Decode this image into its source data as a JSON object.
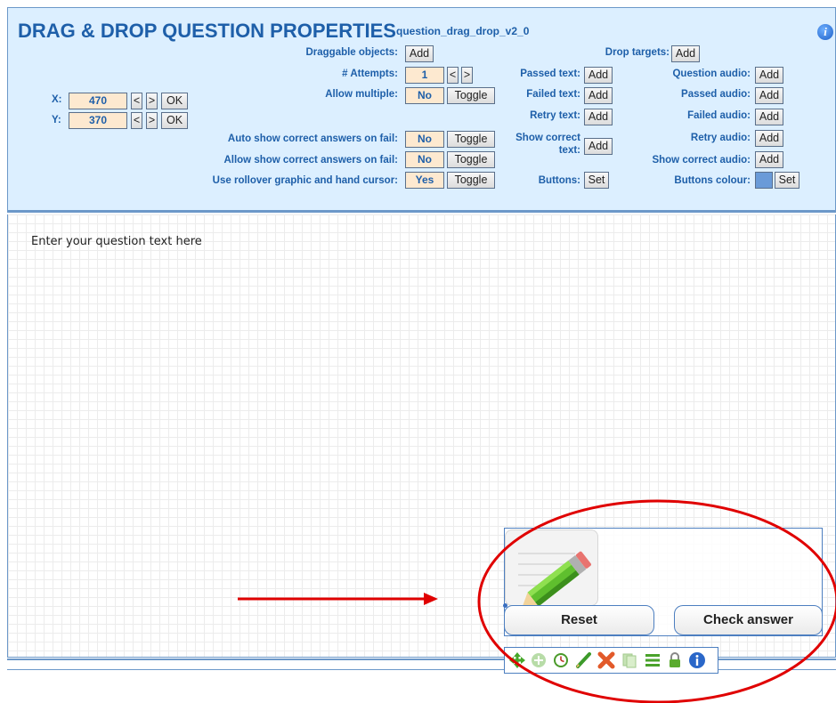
{
  "header": {
    "title": "DRAG & DROP QUESTION PROPERTIES",
    "subtitle": "question_drag_drop_v2_0",
    "info_icon_glyph": "i"
  },
  "position": {
    "x_label": "X:",
    "x_value": "470",
    "y_label": "Y:",
    "y_value": "370",
    "dec_label": "<",
    "inc_label": ">",
    "ok_label": "OK"
  },
  "settings": {
    "draggable_label": "Draggable objects:",
    "attempts_label": "# Attempts:",
    "attempts_value": "1",
    "allow_multiple_label": "Allow multiple:",
    "allow_multiple_value": "No",
    "auto_show_label": "Auto show correct answers on fail:",
    "auto_show_value": "No",
    "allow_show_label": "Allow show correct answers on fail:",
    "allow_show_value": "No",
    "rollover_label": "Use rollover graphic and hand cursor:",
    "rollover_value": "Yes",
    "add_label": "Add",
    "toggle_label": "Toggle",
    "set_label": "Set"
  },
  "feedback": {
    "drop_targets_label": "Drop targets:",
    "passed_text_label": "Passed text:",
    "failed_text_label": "Failed text:",
    "retry_text_label": "Retry text:",
    "show_correct_text_label_1": "Show correct",
    "show_correct_text_label_2": "text:",
    "buttons_label": "Buttons:"
  },
  "audio": {
    "question_audio_label": "Question audio:",
    "passed_audio_label": "Passed audio:",
    "failed_audio_label": "Failed audio:",
    "retry_audio_label": "Retry audio:",
    "show_correct_audio_label": "Show correct audio:",
    "buttons_colour_label": "Buttons colour:"
  },
  "colors": {
    "panel_bg": "#dcefff",
    "label_blue": "#1e5fa9",
    "buttons_colour_swatch": "#6a9bd8",
    "annotation_red": "#e00000"
  },
  "canvas": {
    "question_text": "Enter your question text here"
  },
  "widget": {
    "reset_label": "Reset",
    "check_label": "Check answer"
  },
  "toolbar": {
    "icons": [
      "move-icon",
      "add-icon",
      "clock-icon",
      "edit-icon",
      "delete-icon",
      "copy-icon",
      "list-icon",
      "lock-icon",
      "info-icon"
    ]
  }
}
